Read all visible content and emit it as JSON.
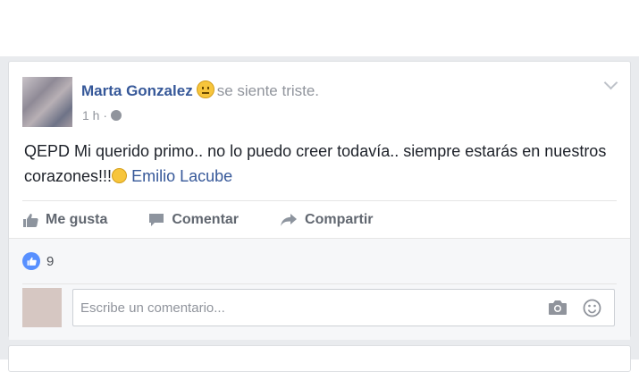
{
  "post": {
    "author": "Marta Gonzalez",
    "feeling": "se siente triste.",
    "time": "1 h",
    "separator": "·",
    "text_main": "QEPD Mi querido primo.. no lo puedo creer todavía.. siempre estarás en nuestros corazones!!!",
    "tagged": "Emilio Lacube"
  },
  "actions": {
    "like": "Me gusta",
    "comment": "Comentar",
    "share": "Compartir"
  },
  "reactions": {
    "count": "9"
  },
  "comment_box": {
    "placeholder": "Escribe un comentario..."
  },
  "colors": {
    "link": "#365899",
    "muted": "#90949c",
    "like_blue": "#5890ff",
    "feed_bg": "#e9ebee"
  }
}
